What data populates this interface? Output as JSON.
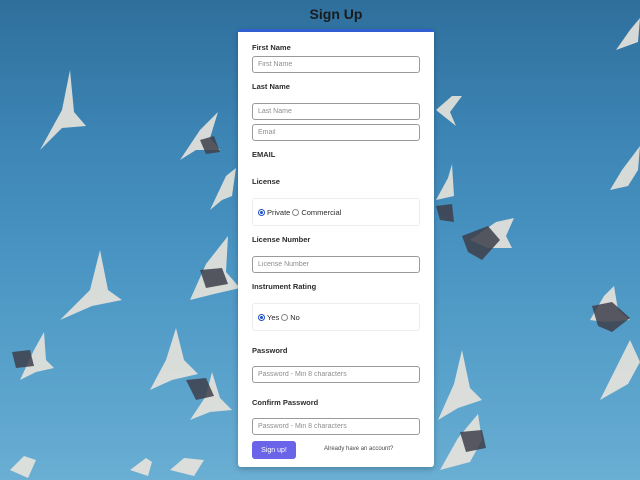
{
  "page": {
    "title": "Sign Up"
  },
  "form": {
    "first_name": {
      "label": "First Name",
      "placeholder": "First Name"
    },
    "last_name": {
      "label": "Last Name",
      "placeholder": "Last Name"
    },
    "email": {
      "placeholder": "Email",
      "label": "EMAIL"
    },
    "license": {
      "label": "License",
      "options": [
        "Private",
        "Commercial"
      ],
      "selected": "Private"
    },
    "license_number": {
      "label": "License Number",
      "placeholder": "License Number"
    },
    "instrument_rating": {
      "label": "Instrument Rating",
      "options": [
        "Yes",
        "No"
      ],
      "selected": "Yes"
    },
    "password": {
      "label": "Password",
      "placeholder": "Password - Min 8 characters"
    },
    "confirm_password": {
      "label": "Confirm Password",
      "placeholder": "Password - Min 8 characters"
    },
    "submit_label": "Sign up!",
    "login_link": "Already have an account?"
  },
  "colors": {
    "accent": "#2f5fd0",
    "button": "#6a64e8",
    "background_sky": "#4a95c3"
  }
}
